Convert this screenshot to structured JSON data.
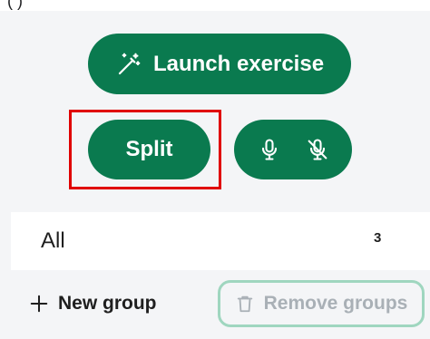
{
  "header": {
    "cropped_text": "(          )"
  },
  "controls": {
    "launch_label": "Launch exercise",
    "launch_icon": "magic-wand-icon",
    "split_label": "Split",
    "mic_on_icon": "microphone-icon",
    "mic_off_icon": "microphone-off-icon",
    "accent_color": "#0a7a4f"
  },
  "groups": {
    "items": [
      {
        "name": "All",
        "count": "3"
      }
    ],
    "new_group_label": "New group",
    "new_group_icon": "plus-icon",
    "remove_label": "Remove groups",
    "remove_icon": "trash-icon"
  }
}
